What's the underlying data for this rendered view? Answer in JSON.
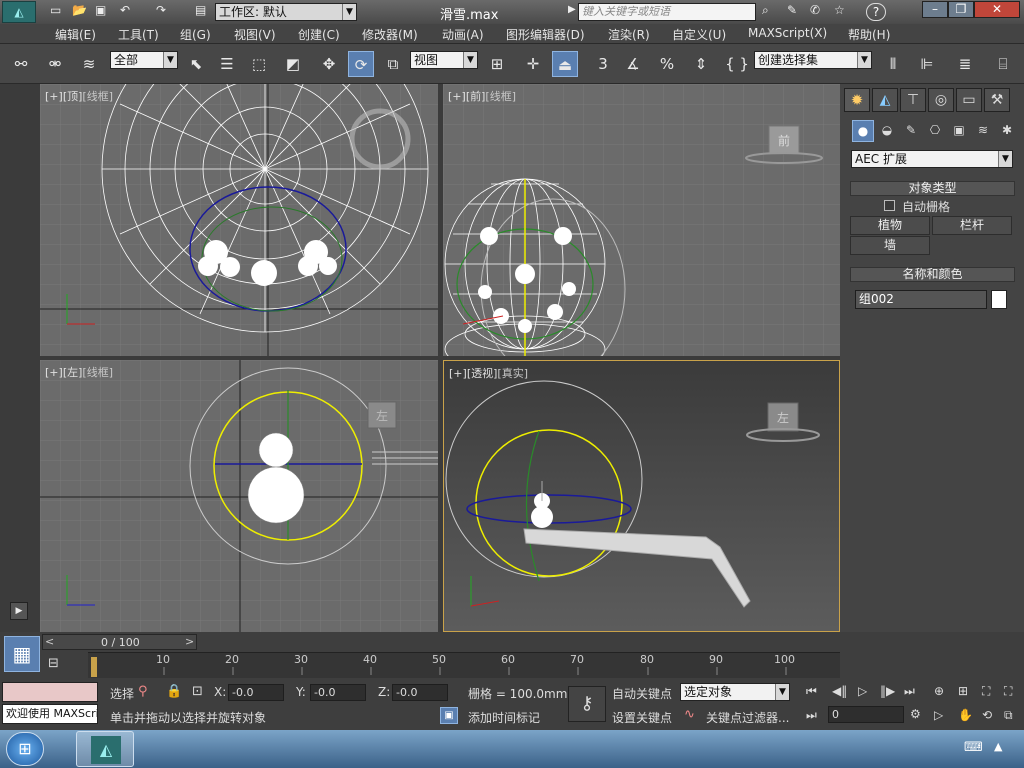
{
  "window": {
    "title": "滑雪.max",
    "workspace_label": "工作区: 默认",
    "search_placeholder": "键入关键字或短语",
    "help_label": "?"
  },
  "menu": [
    "编辑(E)",
    "工具(T)",
    "组(G)",
    "视图(V)",
    "创建(C)",
    "修改器(M)",
    "动画(A)",
    "图形编辑器(D)",
    "渲染(R)",
    "自定义(U)",
    "MAXScript(X)",
    "帮助(H)"
  ],
  "toolbar": {
    "selection_filter": "全部",
    "reference_coord": "视图",
    "named_selection": "创建选择集",
    "snap_label": "3"
  },
  "viewports": {
    "top": {
      "label": "[+][顶][线框]",
      "plus": "[+]",
      "view": "[顶]",
      "mode": "[线框]"
    },
    "front": {
      "label": "[+][前][线框]",
      "plus": "[+]",
      "view": "[前]",
      "mode": "[线框]",
      "cube": "前"
    },
    "left": {
      "label": "[+][左][线框]",
      "plus": "[+]",
      "view": "[左]",
      "mode": "[线框]",
      "cube": "左"
    },
    "persp": {
      "label": "[+][透视][真实]",
      "plus": "[+]",
      "view": "[透视]",
      "mode": "[真实]",
      "cube": "左"
    }
  },
  "command_panel": {
    "category": "AEC 扩展",
    "object_type_header": "对象类型",
    "auto_grid": "自动栅格",
    "buttons": [
      "植物",
      "栏杆",
      "墙"
    ],
    "name_color_header": "名称和颜色",
    "object_name": "组002",
    "swatch_color": "#ffffff"
  },
  "timeline": {
    "frame_counter": "0 / 100",
    "ticks": [
      "10",
      "20",
      "30",
      "40",
      "50",
      "60",
      "70",
      "80",
      "90",
      "100"
    ]
  },
  "status": {
    "maxscript_text": "欢迎使用 MAXScri",
    "selection_label": "选择",
    "x_label": "X:",
    "x_value": "-0.0",
    "y_label": "Y:",
    "y_value": "-0.0",
    "z_label": "Z:",
    "z_value": "-0.0",
    "grid": "栅格 = 100.0mm",
    "prompt": "单击并拖动以选择并旋转对象",
    "add_time_tag": "添加时间标记",
    "auto_key": "自动关键点",
    "set_key": "设置关键点",
    "key_mode": "选定对象",
    "key_filters": "关键点过滤器...",
    "frame_field": "0"
  },
  "colors": {
    "accent": "#5a7fb0",
    "viewport_bg": "#6b6b6b",
    "wire_yellow": "#ffff00",
    "wire_blue": "#0000aa",
    "wire_green": "#00aa00"
  }
}
